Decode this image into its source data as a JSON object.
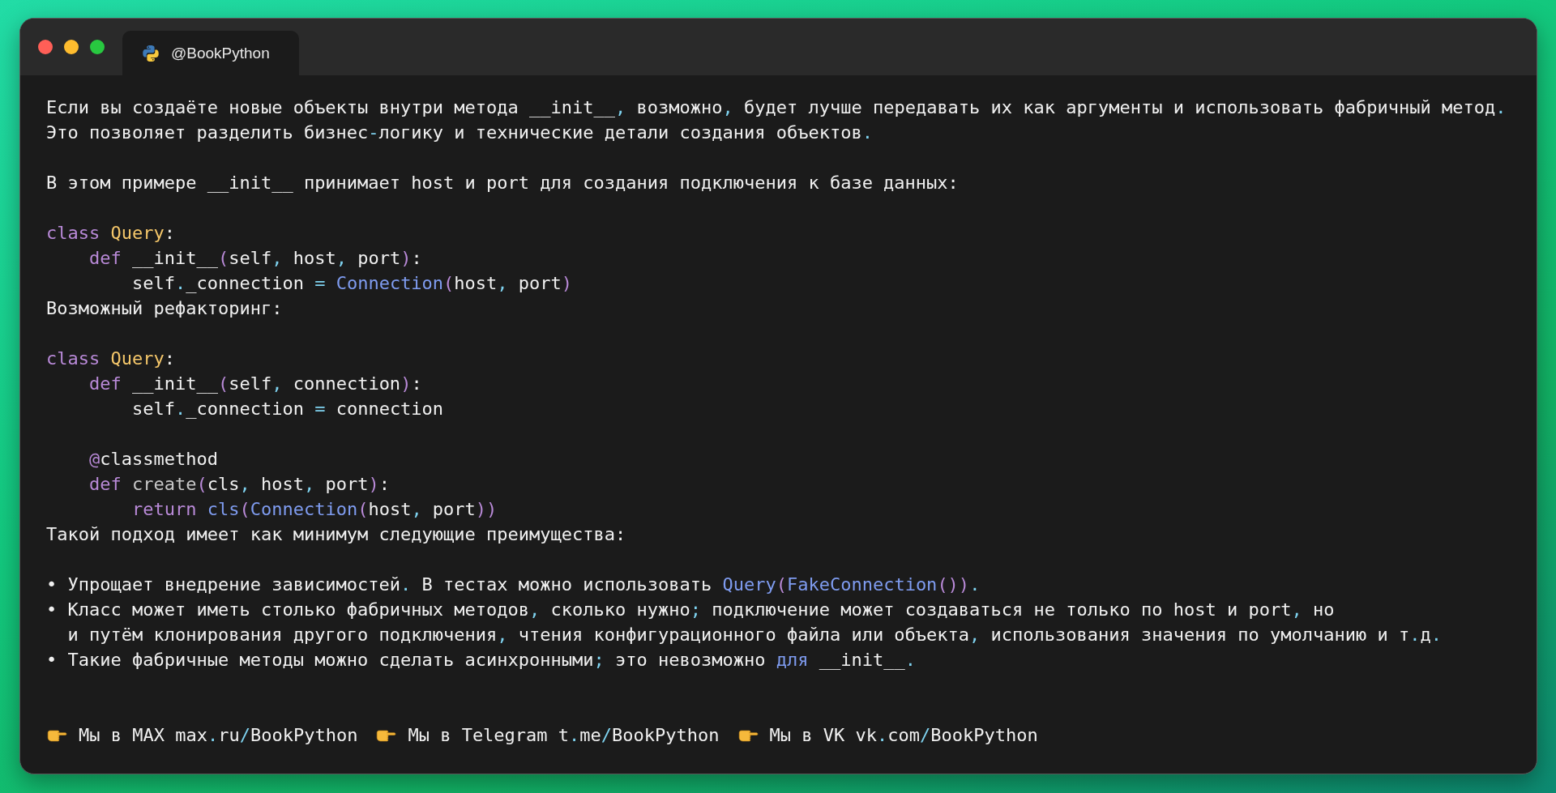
{
  "tabs": [
    {
      "label": "@BookPython",
      "selected": true
    }
  ],
  "blocks": [
    {
      "lines": [
        {
          "tokens": [
            {
              "text": "Если вы создаёте новые объекты внутри метода __init__",
              "kind": "plain"
            },
            {
              "text": ",",
              "kind": "punct"
            },
            {
              "text": " возможно",
              "kind": "plain"
            },
            {
              "text": ",",
              "kind": "punct"
            },
            {
              "text": " будет лучше передавать их как аргументы и использовать фабричный метод",
              "kind": "plain"
            },
            {
              "text": ".",
              "kind": "punct"
            }
          ]
        },
        {
          "tokens": [
            {
              "text": "Это позволяет разделить бизнес",
              "kind": "plain"
            },
            {
              "text": "-",
              "kind": "punct"
            },
            {
              "text": "логику и технические детали создания объектов",
              "kind": "plain"
            },
            {
              "text": ".",
              "kind": "punct"
            }
          ]
        }
      ]
    },
    {
      "lines": [
        {
          "tokens": [
            {
              "text": "В этом примере __init__ принимает host и port для создания подключения к базе данных:",
              "kind": "plain"
            }
          ]
        }
      ]
    },
    {
      "lines": [
        {
          "tokens": [
            {
              "text": "class ",
              "kind": "keyword"
            },
            {
              "text": "Query",
              "kind": "class_name"
            },
            {
              "text": ":",
              "kind": "plain"
            }
          ]
        },
        {
          "tokens": [
            {
              "text": "    def",
              "kind": "keyword"
            },
            {
              "text": " __init__",
              "kind": "plain"
            },
            {
              "text": "(",
              "kind": "bracket"
            },
            {
              "text": "self",
              "kind": "plain"
            },
            {
              "text": ",",
              "kind": "punct"
            },
            {
              "text": " host",
              "kind": "plain"
            },
            {
              "text": ",",
              "kind": "punct"
            },
            {
              "text": " port",
              "kind": "plain"
            },
            {
              "text": ")",
              "kind": "bracket"
            },
            {
              "text": ":",
              "kind": "plain"
            }
          ]
        },
        {
          "tokens": [
            {
              "text": "        self",
              "kind": "plain"
            },
            {
              "text": ".",
              "kind": "punct"
            },
            {
              "text": "_connection ",
              "kind": "plain"
            },
            {
              "text": "= ",
              "kind": "punct"
            },
            {
              "text": "Connection",
              "kind": "call"
            },
            {
              "text": "(",
              "kind": "bracket"
            },
            {
              "text": "host",
              "kind": "plain"
            },
            {
              "text": ",",
              "kind": "punct"
            },
            {
              "text": " port",
              "kind": "plain"
            },
            {
              "text": ")",
              "kind": "bracket"
            }
          ]
        },
        {
          "tokens": [
            {
              "text": "Возможный рефакторинг:",
              "kind": "plain"
            }
          ]
        }
      ]
    },
    {
      "lines": [
        {
          "tokens": [
            {
              "text": "class ",
              "kind": "keyword"
            },
            {
              "text": "Query",
              "kind": "class_name"
            },
            {
              "text": ":",
              "kind": "plain"
            }
          ]
        },
        {
          "tokens": [
            {
              "text": "    def",
              "kind": "keyword"
            },
            {
              "text": " __init__",
              "kind": "plain"
            },
            {
              "text": "(",
              "kind": "bracket"
            },
            {
              "text": "self",
              "kind": "plain"
            },
            {
              "text": ",",
              "kind": "punct"
            },
            {
              "text": " connection",
              "kind": "plain"
            },
            {
              "text": ")",
              "kind": "bracket"
            },
            {
              "text": ":",
              "kind": "plain"
            }
          ]
        },
        {
          "tokens": [
            {
              "text": "        self",
              "kind": "plain"
            },
            {
              "text": ".",
              "kind": "punct"
            },
            {
              "text": "_connection ",
              "kind": "plain"
            },
            {
              "text": "=",
              "kind": "punct"
            },
            {
              "text": " connection",
              "kind": "plain"
            }
          ]
        }
      ]
    },
    {
      "lines": [
        {
          "tokens": [
            {
              "text": "    @",
              "kind": "keyword"
            },
            {
              "text": "classmethod",
              "kind": "plain"
            }
          ]
        },
        {
          "tokens": [
            {
              "text": "    def ",
              "kind": "keyword"
            },
            {
              "text": "create",
              "kind": "method_name"
            },
            {
              "text": "(",
              "kind": "bracket"
            },
            {
              "text": "cls",
              "kind": "plain"
            },
            {
              "text": ",",
              "kind": "punct"
            },
            {
              "text": " host",
              "kind": "plain"
            },
            {
              "text": ",",
              "kind": "punct"
            },
            {
              "text": " port",
              "kind": "plain"
            },
            {
              "text": ")",
              "kind": "bracket"
            },
            {
              "text": ":",
              "kind": "plain"
            }
          ]
        },
        {
          "tokens": [
            {
              "text": "        return ",
              "kind": "keyword"
            },
            {
              "text": "cls",
              "kind": "call"
            },
            {
              "text": "(",
              "kind": "bracket"
            },
            {
              "text": "Connection",
              "kind": "call"
            },
            {
              "text": "(",
              "kind": "bracket"
            },
            {
              "text": "host",
              "kind": "plain"
            },
            {
              "text": ",",
              "kind": "punct"
            },
            {
              "text": " port",
              "kind": "plain"
            },
            {
              "text": "))",
              "kind": "bracket"
            }
          ]
        },
        {
          "tokens": [
            {
              "text": "Такой подход имеет как минимум следующие преимущества:",
              "kind": "plain"
            }
          ]
        }
      ]
    },
    {
      "lines": [
        {
          "tokens": [
            {
              "text": "• Упрощает внедрение зависимостей",
              "kind": "plain"
            },
            {
              "text": ".",
              "kind": "punct"
            },
            {
              "text": " В тестах можно использовать ",
              "kind": "plain"
            },
            {
              "text": "Query",
              "kind": "call"
            },
            {
              "text": "(",
              "kind": "bracket"
            },
            {
              "text": "FakeConnection",
              "kind": "call"
            },
            {
              "text": "())",
              "kind": "bracket"
            },
            {
              "text": ".",
              "kind": "punct"
            }
          ]
        },
        {
          "tokens": [
            {
              "text": "• Класс может иметь столько фабричных методов",
              "kind": "plain"
            },
            {
              "text": ",",
              "kind": "punct"
            },
            {
              "text": " сколько нужно",
              "kind": "plain"
            },
            {
              "text": ";",
              "kind": "punct"
            },
            {
              "text": " подключение может создаваться не только по host и port",
              "kind": "plain"
            },
            {
              "text": ",",
              "kind": "punct"
            },
            {
              "text": " но",
              "kind": "plain"
            }
          ]
        },
        {
          "tokens": [
            {
              "text": "  и путём клонирования другого подключения",
              "kind": "plain"
            },
            {
              "text": ",",
              "kind": "punct"
            },
            {
              "text": " чтения конфигурационного файла или объекта",
              "kind": "plain"
            },
            {
              "text": ",",
              "kind": "punct"
            },
            {
              "text": " использования значения по умолчанию и т",
              "kind": "plain"
            },
            {
              "text": ".",
              "kind": "punct"
            },
            {
              "text": "д",
              "kind": "plain"
            },
            {
              "text": ".",
              "kind": "punct"
            }
          ]
        },
        {
          "tokens": [
            {
              "text": "• Такие фабричные методы можно сделать асинхронными",
              "kind": "plain"
            },
            {
              "text": ";",
              "kind": "punct"
            },
            {
              "text": " это невозможно ",
              "kind": "plain"
            },
            {
              "text": "для",
              "kind": "call"
            },
            {
              "text": " __init__",
              "kind": "plain"
            },
            {
              "text": ".",
              "kind": "punct"
            }
          ]
        }
      ]
    }
  ],
  "footer_links": [
    {
      "tokens": [
        {
          "text": "Мы в MAX max",
          "kind": "plain"
        },
        {
          "text": ".",
          "kind": "punct"
        },
        {
          "text": "ru",
          "kind": "plain"
        },
        {
          "text": "/",
          "kind": "punct"
        },
        {
          "text": "BookPython",
          "kind": "plain"
        }
      ]
    },
    {
      "tokens": [
        {
          "text": "Мы в Telegram t",
          "kind": "plain"
        },
        {
          "text": ".",
          "kind": "punct"
        },
        {
          "text": "me",
          "kind": "plain"
        },
        {
          "text": "/",
          "kind": "punct"
        },
        {
          "text": "BookPython",
          "kind": "plain"
        }
      ]
    },
    {
      "tokens": [
        {
          "text": "Мы в VK vk",
          "kind": "plain"
        },
        {
          "text": ".",
          "kind": "punct"
        },
        {
          "text": "com",
          "kind": "plain"
        },
        {
          "text": "/",
          "kind": "punct"
        },
        {
          "text": "BookPython",
          "kind": "plain"
        }
      ]
    }
  ]
}
